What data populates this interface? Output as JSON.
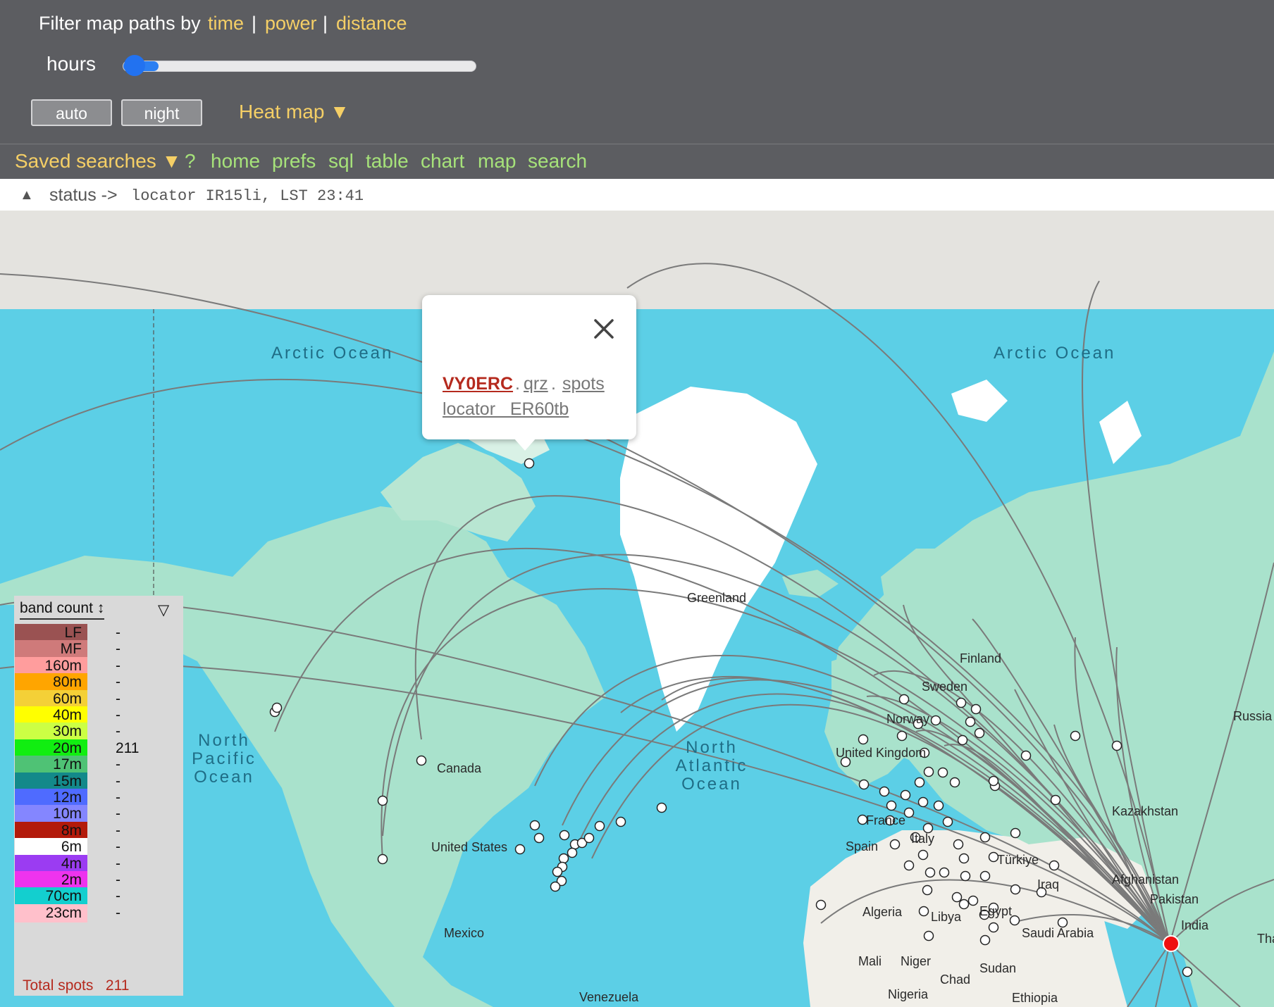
{
  "filter": {
    "label": "Filter map paths by",
    "options": [
      "time",
      "power",
      "distance"
    ],
    "separator": "|"
  },
  "slider": {
    "label": "hours",
    "value_fraction": 0.04
  },
  "buttons": {
    "auto": "auto",
    "night": "night"
  },
  "heatmap": "Heat map ▼",
  "nav": {
    "saved": "Saved searches ▼",
    "links": [
      "?",
      "home",
      "prefs",
      "sql",
      "table",
      "chart",
      "map",
      "search"
    ]
  },
  "status": {
    "arrow": "▲",
    "label": "status ->",
    "text": "locator IR15li, LST 23:41"
  },
  "popup": {
    "close_icon": "close-icon",
    "callsign": "VY0ERC",
    "sep": ".",
    "qrz": "qrz",
    "spots": "spots",
    "locator": "locator   ER60tb"
  },
  "map": {
    "labels": [
      "Greenland",
      "Canada",
      "United States",
      "Mexico",
      "Venezuela",
      "Finland",
      "Sweden",
      "Norway",
      "United Kingdom",
      "France",
      "Spain",
      "Italy",
      "Türkiye",
      "Iraq",
      "Afghanistan",
      "Pakistan",
      "India",
      "Kazakhstan",
      "Russia",
      "Algeria",
      "Libya",
      "Egypt",
      "Saudi Arabia",
      "Mali",
      "Niger",
      "Chad",
      "Sudan",
      "Nigeria",
      "Ethiopia",
      "Tha"
    ],
    "oceans": [
      "Arctic Ocean",
      "Arctic Ocean",
      "North Pacific Ocean",
      "North Atlantic Ocean"
    ],
    "colors": {
      "ocean": "#5ccfe6",
      "land": "#a9e2cc",
      "ice": "#ffffff",
      "path": "#7a7a7a",
      "home_marker": "#ee1111",
      "polar": "#e4e3df"
    }
  },
  "legend": {
    "header": "band count ↕",
    "filter_icon": "▽",
    "bands": [
      {
        "name": "LF",
        "count": "-",
        "color": "#9a5252"
      },
      {
        "name": "MF",
        "count": "-",
        "color": "#cf7a7a"
      },
      {
        "name": "160m",
        "count": "-",
        "color": "#ff9d9d"
      },
      {
        "name": "80m",
        "count": "-",
        "color": "#ffa500"
      },
      {
        "name": "60m",
        "count": "-",
        "color": "#f4d037"
      },
      {
        "name": "40m",
        "count": "-",
        "color": "#ffff00"
      },
      {
        "name": "30m",
        "count": "-",
        "color": "#ccff44"
      },
      {
        "name": "20m",
        "count": "211",
        "color": "#11ee11"
      },
      {
        "name": "17m",
        "count": "-",
        "color": "#4fc275"
      },
      {
        "name": "15m",
        "count": "-",
        "color": "#13898a"
      },
      {
        "name": "12m",
        "count": "-",
        "color": "#4f6bff"
      },
      {
        "name": "10m",
        "count": "-",
        "color": "#8486ff"
      },
      {
        "name": "8m",
        "count": "-",
        "color": "#b31a0a"
      },
      {
        "name": "6m",
        "count": "-",
        "color": "#ffffff"
      },
      {
        "name": "4m",
        "count": "-",
        "color": "#9b3cf2"
      },
      {
        "name": "2m",
        "count": "-",
        "color": "#ee33ee"
      },
      {
        "name": "70cm",
        "count": "-",
        "color": "#13cfcf"
      },
      {
        "name": "23cm",
        "count": "-",
        "color": "#ffc0cb"
      }
    ],
    "total_label": "Total spots",
    "total": "211"
  }
}
